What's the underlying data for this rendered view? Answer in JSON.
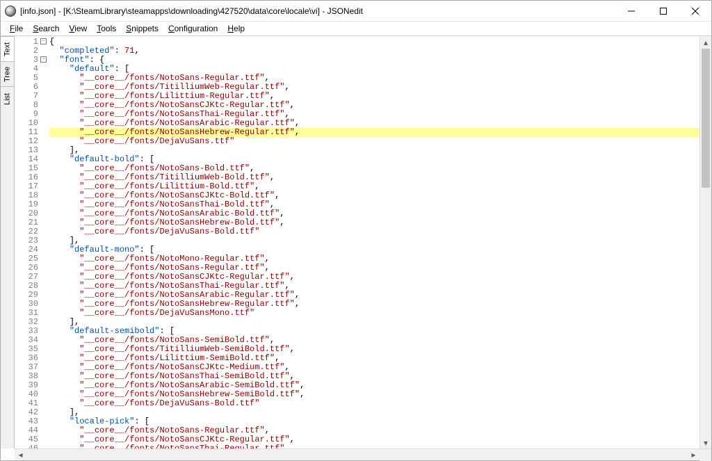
{
  "window": {
    "title": "[info.json] - [K:\\SteamLibrary\\steamapps\\downloading\\427520\\data\\core\\locale\\vi] - JSONedit"
  },
  "menu": {
    "file": "File",
    "search": "Search",
    "view": "View",
    "tools": "Tools",
    "snippets": "Snippets",
    "configuration": "Configuration",
    "help": "Help"
  },
  "sidetabs": {
    "text": "Text",
    "tree": "Tree",
    "list": "List"
  },
  "highlighted_line": 11,
  "code_lines": [
    {
      "n": 1,
      "fold": true,
      "indent": 0,
      "tokens": [
        {
          "t": "{",
          "c": "punct"
        }
      ]
    },
    {
      "n": 2,
      "indent": 1,
      "tokens": [
        {
          "t": "\"completed\"",
          "c": "key"
        },
        {
          "t": ": ",
          "c": "punct"
        },
        {
          "t": "71",
          "c": "num"
        },
        {
          "t": ",",
          "c": "punct"
        }
      ]
    },
    {
      "n": 3,
      "fold": true,
      "indent": 1,
      "tokens": [
        {
          "t": "\"font\"",
          "c": "key"
        },
        {
          "t": ": {",
          "c": "punct"
        }
      ]
    },
    {
      "n": 4,
      "indent": 2,
      "tokens": [
        {
          "t": "\"default\"",
          "c": "key"
        },
        {
          "t": ": [",
          "c": "punct"
        }
      ]
    },
    {
      "n": 5,
      "indent": 3,
      "tokens": [
        {
          "t": "\"__core__/fonts/NotoSans-Regular.ttf\"",
          "c": "str"
        },
        {
          "t": ",",
          "c": "punct"
        }
      ]
    },
    {
      "n": 6,
      "indent": 3,
      "tokens": [
        {
          "t": "\"__core__/fonts/TitilliumWeb-Regular.ttf\"",
          "c": "str"
        },
        {
          "t": ",",
          "c": "punct"
        }
      ]
    },
    {
      "n": 7,
      "indent": 3,
      "tokens": [
        {
          "t": "\"__core__/fonts/Lilittium-Regular.ttf\"",
          "c": "str"
        },
        {
          "t": ",",
          "c": "punct"
        }
      ]
    },
    {
      "n": 8,
      "indent": 3,
      "tokens": [
        {
          "t": "\"__core__/fonts/NotoSansCJKtc-Regular.ttf\"",
          "c": "str"
        },
        {
          "t": ",",
          "c": "punct"
        }
      ]
    },
    {
      "n": 9,
      "indent": 3,
      "tokens": [
        {
          "t": "\"__core__/fonts/NotoSansThai-Regular.ttf\"",
          "c": "str"
        },
        {
          "t": ",",
          "c": "punct"
        }
      ]
    },
    {
      "n": 10,
      "indent": 3,
      "tokens": [
        {
          "t": "\"__core__/fonts/NotoSansArabic-Regular.ttf\"",
          "c": "str"
        },
        {
          "t": ",",
          "c": "punct"
        }
      ]
    },
    {
      "n": 11,
      "indent": 3,
      "tokens": [
        {
          "t": "\"__core__/fonts/NotoSansHebrew-Regular.ttf\"",
          "c": "str"
        },
        {
          "t": ",",
          "c": "punct"
        }
      ]
    },
    {
      "n": 12,
      "indent": 3,
      "tokens": [
        {
          "t": "\"__core__/fonts/DejaVuSans.ttf\"",
          "c": "str"
        }
      ]
    },
    {
      "n": 13,
      "indent": 2,
      "tokens": [
        {
          "t": "],",
          "c": "punct"
        }
      ]
    },
    {
      "n": 14,
      "indent": 2,
      "tokens": [
        {
          "t": "\"default-bold\"",
          "c": "key"
        },
        {
          "t": ": [",
          "c": "punct"
        }
      ]
    },
    {
      "n": 15,
      "indent": 3,
      "tokens": [
        {
          "t": "\"__core__/fonts/NotoSans-Bold.ttf\"",
          "c": "str"
        },
        {
          "t": ",",
          "c": "punct"
        }
      ]
    },
    {
      "n": 16,
      "indent": 3,
      "tokens": [
        {
          "t": "\"__core__/fonts/TitilliumWeb-Bold.ttf\"",
          "c": "str"
        },
        {
          "t": ",",
          "c": "punct"
        }
      ]
    },
    {
      "n": 17,
      "indent": 3,
      "tokens": [
        {
          "t": "\"__core__/fonts/Lilittium-Bold.ttf\"",
          "c": "str"
        },
        {
          "t": ",",
          "c": "punct"
        }
      ]
    },
    {
      "n": 18,
      "indent": 3,
      "tokens": [
        {
          "t": "\"__core__/fonts/NotoSansCJKtc-Bold.ttf\"",
          "c": "str"
        },
        {
          "t": ",",
          "c": "punct"
        }
      ]
    },
    {
      "n": 19,
      "indent": 3,
      "tokens": [
        {
          "t": "\"__core__/fonts/NotoSansThai-Bold.ttf\"",
          "c": "str"
        },
        {
          "t": ",",
          "c": "punct"
        }
      ]
    },
    {
      "n": 20,
      "indent": 3,
      "tokens": [
        {
          "t": "\"__core__/fonts/NotoSansArabic-Bold.ttf\"",
          "c": "str"
        },
        {
          "t": ",",
          "c": "punct"
        }
      ]
    },
    {
      "n": 21,
      "indent": 3,
      "tokens": [
        {
          "t": "\"__core__/fonts/NotoSansHebrew-Bold.ttf\"",
          "c": "str"
        },
        {
          "t": ",",
          "c": "punct"
        }
      ]
    },
    {
      "n": 22,
      "indent": 3,
      "tokens": [
        {
          "t": "\"__core__/fonts/DejaVuSans-Bold.ttf\"",
          "c": "str"
        }
      ]
    },
    {
      "n": 23,
      "indent": 2,
      "tokens": [
        {
          "t": "],",
          "c": "punct"
        }
      ]
    },
    {
      "n": 24,
      "indent": 2,
      "tokens": [
        {
          "t": "\"default-mono\"",
          "c": "key"
        },
        {
          "t": ": [",
          "c": "punct"
        }
      ]
    },
    {
      "n": 25,
      "indent": 3,
      "tokens": [
        {
          "t": "\"__core__/fonts/NotoMono-Regular.ttf\"",
          "c": "str"
        },
        {
          "t": ",",
          "c": "punct"
        }
      ]
    },
    {
      "n": 26,
      "indent": 3,
      "tokens": [
        {
          "t": "\"__core__/fonts/NotoSans-Regular.ttf\"",
          "c": "str"
        },
        {
          "t": ",",
          "c": "punct"
        }
      ]
    },
    {
      "n": 27,
      "indent": 3,
      "tokens": [
        {
          "t": "\"__core__/fonts/NotoSansCJKtc-Regular.ttf\"",
          "c": "str"
        },
        {
          "t": ",",
          "c": "punct"
        }
      ]
    },
    {
      "n": 28,
      "indent": 3,
      "tokens": [
        {
          "t": "\"__core__/fonts/NotoSansThai-Regular.ttf\"",
          "c": "str"
        },
        {
          "t": ",",
          "c": "punct"
        }
      ]
    },
    {
      "n": 29,
      "indent": 3,
      "tokens": [
        {
          "t": "\"__core__/fonts/NotoSansArabic-Regular.ttf\"",
          "c": "str"
        },
        {
          "t": ",",
          "c": "punct"
        }
      ]
    },
    {
      "n": 30,
      "indent": 3,
      "tokens": [
        {
          "t": "\"__core__/fonts/NotoSansHebrew-Regular.ttf\"",
          "c": "str"
        },
        {
          "t": ",",
          "c": "punct"
        }
      ]
    },
    {
      "n": 31,
      "indent": 3,
      "tokens": [
        {
          "t": "\"__core__/fonts/DejaVuSansMono.ttf\"",
          "c": "str"
        }
      ]
    },
    {
      "n": 32,
      "indent": 2,
      "tokens": [
        {
          "t": "],",
          "c": "punct"
        }
      ]
    },
    {
      "n": 33,
      "indent": 2,
      "tokens": [
        {
          "t": "\"default-semibold\"",
          "c": "key"
        },
        {
          "t": ": [",
          "c": "punct"
        }
      ]
    },
    {
      "n": 34,
      "indent": 3,
      "tokens": [
        {
          "t": "\"__core__/fonts/NotoSans-SemiBold.ttf\"",
          "c": "str"
        },
        {
          "t": ",",
          "c": "punct"
        }
      ]
    },
    {
      "n": 35,
      "indent": 3,
      "tokens": [
        {
          "t": "\"__core__/fonts/TitilliumWeb-SemiBold.ttf\"",
          "c": "str"
        },
        {
          "t": ",",
          "c": "punct"
        }
      ]
    },
    {
      "n": 36,
      "indent": 3,
      "tokens": [
        {
          "t": "\"__core__/fonts/Lilittium-SemiBold.ttf\"",
          "c": "str"
        },
        {
          "t": ",",
          "c": "punct"
        }
      ]
    },
    {
      "n": 37,
      "indent": 3,
      "tokens": [
        {
          "t": "\"__core__/fonts/NotoSansCJKtc-Medium.ttf\"",
          "c": "str"
        },
        {
          "t": ",",
          "c": "punct"
        }
      ]
    },
    {
      "n": 38,
      "indent": 3,
      "tokens": [
        {
          "t": "\"__core__/fonts/NotoSansThai-SemiBold.ttf\"",
          "c": "str"
        },
        {
          "t": ",",
          "c": "punct"
        }
      ]
    },
    {
      "n": 39,
      "indent": 3,
      "tokens": [
        {
          "t": "\"__core__/fonts/NotoSansArabic-SemiBold.ttf\"",
          "c": "str"
        },
        {
          "t": ",",
          "c": "punct"
        }
      ]
    },
    {
      "n": 40,
      "indent": 3,
      "tokens": [
        {
          "t": "\"__core__/fonts/NotoSansHebrew-SemiBold.ttf\"",
          "c": "str"
        },
        {
          "t": ",",
          "c": "punct"
        }
      ]
    },
    {
      "n": 41,
      "indent": 3,
      "tokens": [
        {
          "t": "\"__core__/fonts/DejaVuSans-Bold.ttf\"",
          "c": "str"
        }
      ]
    },
    {
      "n": 42,
      "indent": 2,
      "tokens": [
        {
          "t": "],",
          "c": "punct"
        }
      ]
    },
    {
      "n": 43,
      "indent": 2,
      "tokens": [
        {
          "t": "\"locale-pick\"",
          "c": "key"
        },
        {
          "t": ": [",
          "c": "punct"
        }
      ]
    },
    {
      "n": 44,
      "indent": 3,
      "tokens": [
        {
          "t": "\"__core__/fonts/NotoSans-Regular.ttf\"",
          "c": "str"
        },
        {
          "t": ",",
          "c": "punct"
        }
      ]
    },
    {
      "n": 45,
      "indent": 3,
      "tokens": [
        {
          "t": "\"__core__/fonts/NotoSansCJKtc-Regular.ttf\"",
          "c": "str"
        },
        {
          "t": ",",
          "c": "punct"
        }
      ]
    },
    {
      "n": 46,
      "indent": 3,
      "tokens": [
        {
          "t": "\"__core__/fonts/NotoSansThai-Regular.ttf\"",
          "c": "str"
        },
        {
          "t": ",",
          "c": "punct"
        }
      ]
    }
  ]
}
